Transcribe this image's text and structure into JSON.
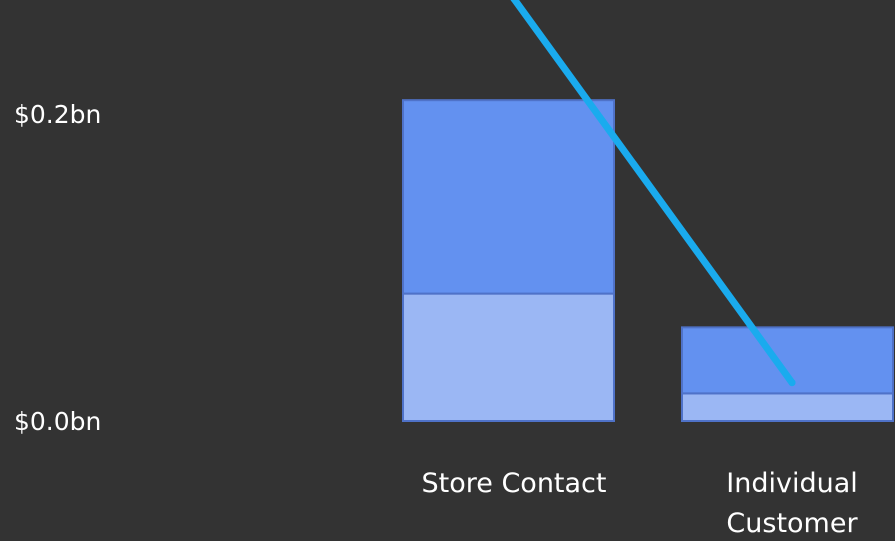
{
  "chart_data": {
    "type": "bar",
    "stacked": true,
    "categories": [
      "Store Contact",
      "Individual Customer"
    ],
    "x_tick_labels": [
      [
        "Store Contact"
      ],
      [
        "Individual",
        "Customer"
      ]
    ],
    "y_ticks": [
      {
        "value": 0.2,
        "label": "$0.2bn"
      },
      {
        "value": 0.0,
        "label": "$0.0bn"
      }
    ],
    "ylim": [
      0,
      0.2
    ],
    "grid": false,
    "series": [
      {
        "values": [
          0.083,
          0.018
        ],
        "color": "#9BB7F4"
      },
      {
        "values": [
          0.126,
          0.043
        ],
        "color": "#6391F0"
      }
    ],
    "line_series": {
      "values": [
        0.275,
        0.025
      ],
      "color": "#1AABEE"
    },
    "colors": {
      "background": "#333333",
      "text": "#FFFFFF",
      "bar_border": "#4F72C8"
    }
  }
}
